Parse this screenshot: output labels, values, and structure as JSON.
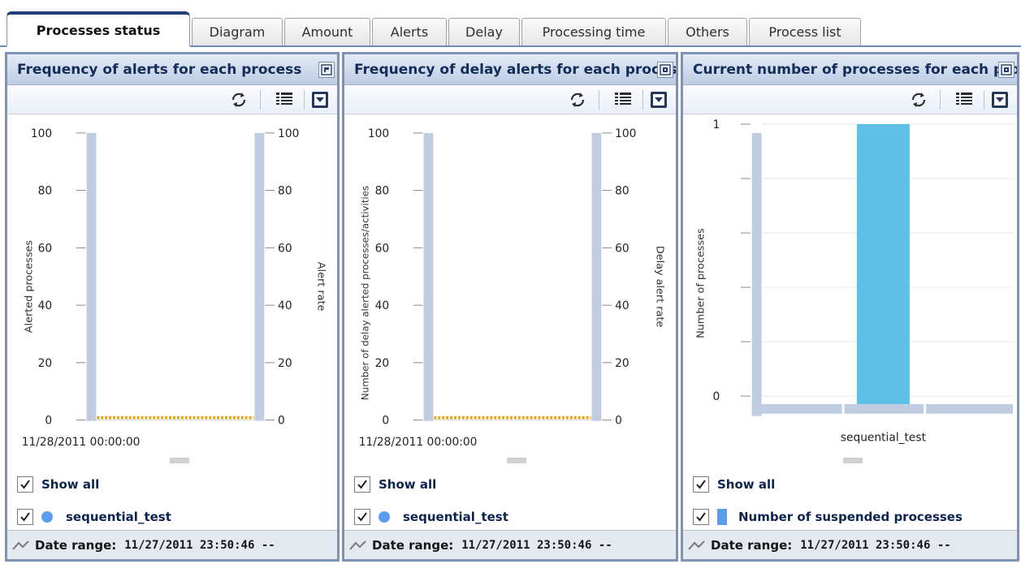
{
  "tabs": [
    {
      "label": "Processes status",
      "active": true
    },
    {
      "label": "Diagram"
    },
    {
      "label": "Amount"
    },
    {
      "label": "Alerts"
    },
    {
      "label": "Delay"
    },
    {
      "label": "Processing time"
    },
    {
      "label": "Others"
    },
    {
      "label": "Process list"
    }
  ],
  "panels": [
    {
      "title": "Frequency of alerts for each process",
      "title_button_icon": "restore-icon",
      "show_all_label": "Show all",
      "legend_label": "sequential_test",
      "date_range_label": "Date range:",
      "date_range_value": "11/27/2011 23:50:46 --"
    },
    {
      "title": "Frequency of delay alerts for each process",
      "title_button_icon": "maximize-icon",
      "show_all_label": "Show all",
      "legend_label": "sequential_test",
      "date_range_label": "Date range:",
      "date_range_value": "11/27/2011 23:50:46 --"
    },
    {
      "title": "Current number of processes for each process",
      "title_button_icon": "maximize-icon",
      "show_all_label": "Show all",
      "legend_label": "Number of suspended processes",
      "date_range_label": "Date range:",
      "date_range_value": "11/27/2011 23:50:46 --"
    }
  ],
  "colors": {
    "accent": "#1f3f78",
    "series": "#5b9cf0",
    "bar": "#5ec0e6",
    "line": "#e8a317",
    "axis_band": "#c0cde0"
  },
  "chart_data": [
    {
      "type": "line",
      "title": "Frequency of alerts for each process",
      "x": [
        "11/28/2011 00:00:00"
      ],
      "series": [
        {
          "name": "sequential_test",
          "values": [
            0
          ]
        }
      ],
      "ylabel": "Alerted processes",
      "y2label": "Alert rate",
      "ylim": [
        0,
        100
      ],
      "y2lim": [
        0,
        100
      ],
      "yticks": [
        "0",
        "20",
        "40",
        "60",
        "80",
        "100"
      ],
      "y2ticks": [
        "0",
        "20",
        "40",
        "60",
        "80",
        "100"
      ],
      "xtick_label": "11/28/2011 00:00:00"
    },
    {
      "type": "line",
      "title": "Frequency of delay alerts for each process",
      "x": [
        "11/28/2011 00:00:00"
      ],
      "series": [
        {
          "name": "sequential_test",
          "values": [
            0
          ]
        }
      ],
      "ylabel": "Number of delay alerted processes/activities",
      "y2label": "Delay alert rate",
      "ylim": [
        0,
        100
      ],
      "y2lim": [
        0,
        100
      ],
      "yticks": [
        "0",
        "20",
        "40",
        "60",
        "80",
        "100"
      ],
      "y2ticks": [
        "0",
        "20",
        "40",
        "60",
        "80",
        "100"
      ],
      "xtick_label": "11/28/2011 00:00:00"
    },
    {
      "type": "bar",
      "title": "Current number of processes for each process",
      "categories": [
        "sequential_test"
      ],
      "series": [
        {
          "name": "Number of suspended processes",
          "values": [
            1
          ]
        }
      ],
      "ylabel": "Number of processes",
      "ylim": [
        0,
        1
      ],
      "yticks": [
        "0",
        "1"
      ]
    }
  ]
}
